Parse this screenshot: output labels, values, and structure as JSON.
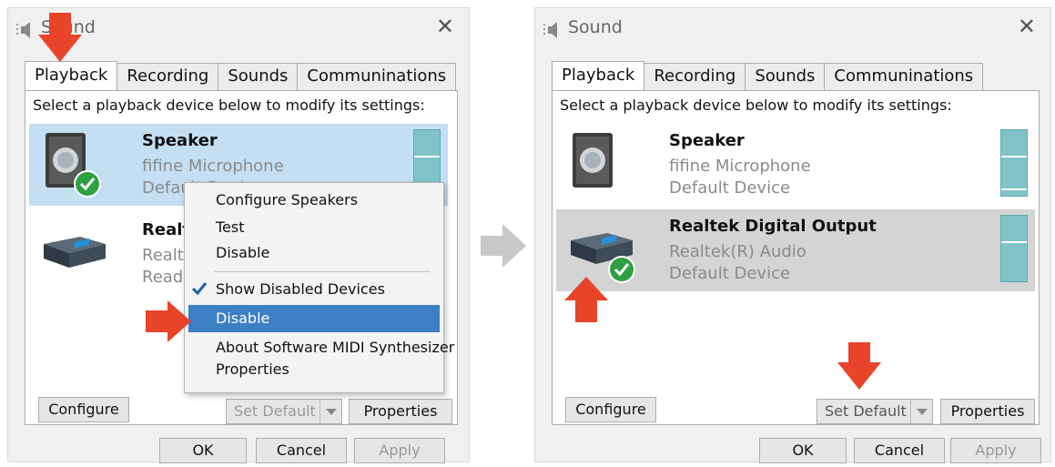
{
  "left": {
    "title": "Sound",
    "tabs": [
      "Playback",
      "Recording",
      "Sounds",
      "Communinations"
    ],
    "instruction": "Select a playback device below to modify its settings:",
    "devices": [
      {
        "name": "Speaker",
        "line1": "fifine Microphone",
        "line2": "Default Device"
      },
      {
        "name": "Realtek Digital Output",
        "line1": "Realtek(R) Audio",
        "line2": "Ready"
      }
    ],
    "context_menu": {
      "items": [
        "Configure Speakers",
        "Test",
        "Disable",
        "Show Disabled Devices",
        "Disable",
        "About Software MIDI Synthesizer",
        "Properties"
      ]
    },
    "buttons": {
      "configure": "Configure",
      "set_default": "Set Default",
      "properties": "Properties",
      "ok": "OK",
      "cancel": "Cancel",
      "apply": "Apply"
    }
  },
  "right": {
    "title": "Sound",
    "tabs": [
      "Playback",
      "Recording",
      "Sounds",
      "Communinations"
    ],
    "instruction": "Select a playback device below to modify its settings:",
    "devices": [
      {
        "name": "Speaker",
        "line1": "fifine Microphone",
        "line2": "Default Device"
      },
      {
        "name": "Realtek Digital Output",
        "line1": "Realtek(R) Audio",
        "line2": "Default Device"
      }
    ],
    "buttons": {
      "configure": "Configure",
      "set_default": "Set Default",
      "properties": "Properties",
      "ok": "OK",
      "cancel": "Cancel",
      "apply": "Apply"
    }
  },
  "colors": {
    "selection_blue": "#c4dff3",
    "selection_gray": "#d4d4d4",
    "menu_highlight": "#3c7fc4",
    "vu_meter": "#7fc3c9",
    "callout_red": "#e8442a",
    "default_check_green": "#2ea043"
  },
  "icons": [
    "sound-app-icon",
    "close-icon",
    "speaker-icon",
    "digital-output-icon",
    "default-check-icon",
    "menu-checkmark-icon",
    "red-callout-arrow",
    "gray-transition-arrow"
  ]
}
